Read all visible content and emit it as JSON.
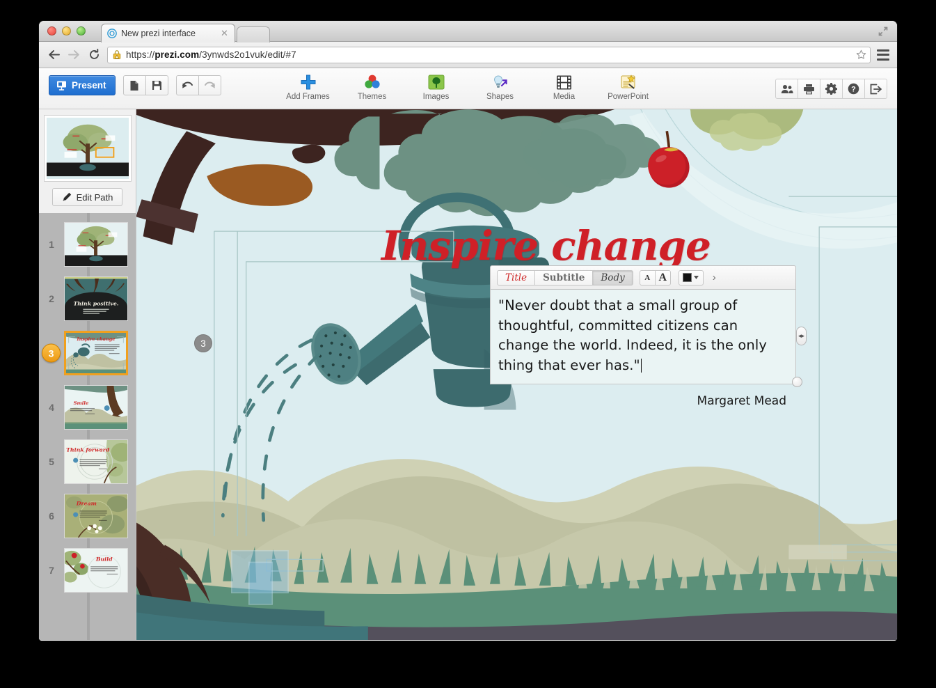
{
  "browser": {
    "tab_title": "New prezi interface",
    "tab_favicon_icon": "prezi-circle-icon",
    "tab_close_icon": "close-icon",
    "back_icon": "back-arrow-icon",
    "forward_icon": "forward-arrow-icon",
    "reload_icon": "reload-icon",
    "lock_icon": "warning-lock-icon",
    "url_scheme": "https://",
    "url_domain": "prezi.com",
    "url_path": "/3ynwds2o1vuk/edit/#7",
    "url_full": "https://prezi.com/3ynwds2o1vuk/edit/#7",
    "star_icon": "bookmark-star-icon",
    "menu_icon": "hamburger-menu-icon",
    "expand_icon": "fullscreen-expand-icon"
  },
  "toolbar": {
    "present_label": "Present",
    "present_icon": "presentation-screen-icon",
    "new_icon": "new-document-icon",
    "save_icon": "save-floppy-icon",
    "undo_icon": "undo-arrow-icon",
    "redo_icon": "redo-arrow-icon",
    "tools": [
      {
        "label": "Add Frames",
        "icon": "blue-plus-icon"
      },
      {
        "label": "Themes",
        "icon": "color-circles-icon"
      },
      {
        "label": "Images",
        "icon": "green-tree-image-icon"
      },
      {
        "label": "Shapes",
        "icon": "bulb-arrow-icon"
      },
      {
        "label": "Media",
        "icon": "film-strip-icon"
      },
      {
        "label": "PowerPoint",
        "icon": "powerpoint-import-icon"
      }
    ],
    "right_buttons": [
      {
        "name": "share-people",
        "icon": "people-icon"
      },
      {
        "name": "print",
        "icon": "printer-icon"
      },
      {
        "name": "settings",
        "icon": "gear-icon"
      },
      {
        "name": "help",
        "icon": "question-mark-icon"
      },
      {
        "name": "exit",
        "icon": "exit-arrow-icon"
      }
    ]
  },
  "sidebar": {
    "edit_path_label": "Edit Path",
    "edit_path_icon": "pencil-icon",
    "current_slide": "3",
    "thumbs": [
      {
        "num": "1",
        "title": "",
        "kind": "tree-overview"
      },
      {
        "num": "2",
        "title": "Think positive.",
        "kind": "roots-dark"
      },
      {
        "num": "3",
        "title": "Inspire change",
        "kind": "watering-can"
      },
      {
        "num": "4",
        "title": "Smile",
        "kind": "trunk-right"
      },
      {
        "num": "5",
        "title": "Think forward",
        "kind": "branch-light"
      },
      {
        "num": "6",
        "title": "Dream",
        "kind": "blossoms-olive"
      },
      {
        "num": "7",
        "title": "Build",
        "kind": "apples-light"
      }
    ]
  },
  "canvas": {
    "slide_number_badge": "3",
    "title": "Inspire change",
    "title_color": "#cf2027",
    "background_color": "#dcedf0",
    "hill_color": "#bfc1a2",
    "grass_color": "#5b9079",
    "ground_color": "#54505c",
    "foliage_color": "#6d9183",
    "trunk_color": "#3d2420",
    "trunk_highlight_color": "#9a5a22",
    "can_color": "#3d6b6e",
    "apple_color": "#cc2028",
    "selection_color": "#7fb9dd"
  },
  "text_editor": {
    "styles": [
      {
        "label": "Title",
        "active": false
      },
      {
        "label": "Subtitle",
        "active": false
      },
      {
        "label": "Body",
        "active": true
      }
    ],
    "decrease_size_icon": "small-A-icon",
    "increase_size_icon": "large-A-icon",
    "color_swatch": "#121212",
    "color_dropdown_icon": "caret-down-icon",
    "more_icon": "chevron-right-icon",
    "quote": "\"Never doubt that a small group of thoughtful, committed citizens can change the world. Indeed, it is the only thing that ever has.\"",
    "attribution": "Margaret Mead",
    "width_handle_icon": "horizontal-resize-icon",
    "corner_handle_icon": "resize-dot-icon"
  }
}
